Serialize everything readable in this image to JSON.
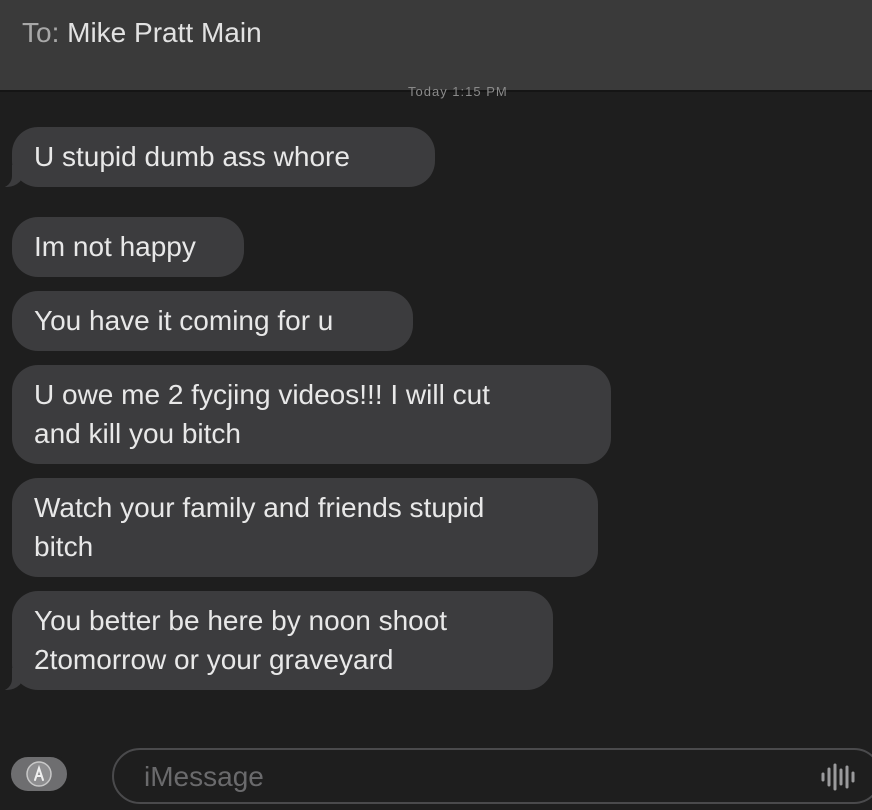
{
  "header": {
    "to_label": "To:",
    "recipient": "Mike Pratt Main",
    "timestamp": "Today 1:15 PM"
  },
  "messages": [
    {
      "lines": [
        "U stupid dumb ass whore"
      ],
      "tail": true
    },
    {
      "lines": [
        "Im not happy"
      ],
      "tail": false
    },
    {
      "lines": [
        "You have it coming for u"
      ],
      "tail": false
    },
    {
      "lines": [
        "U owe me 2 fycjing videos!!!  I will cut",
        "and kill you bitch"
      ],
      "tail": false
    },
    {
      "lines": [
        "Watch your family and friends stupid",
        "bitch"
      ],
      "tail": false
    },
    {
      "lines": [
        "You better be here by noon shoot",
        "2tomorrow or your graveyard"
      ],
      "tail": true
    }
  ],
  "composer": {
    "placeholder": "iMessage",
    "apps_icon": "app-store-icon",
    "audio_icon": "audio-waveform-icon"
  },
  "colors": {
    "background": "#1e1e1e",
    "header": "#3a3a3a",
    "bubble": "#3c3c3e",
    "text": "#e8e8e8"
  }
}
